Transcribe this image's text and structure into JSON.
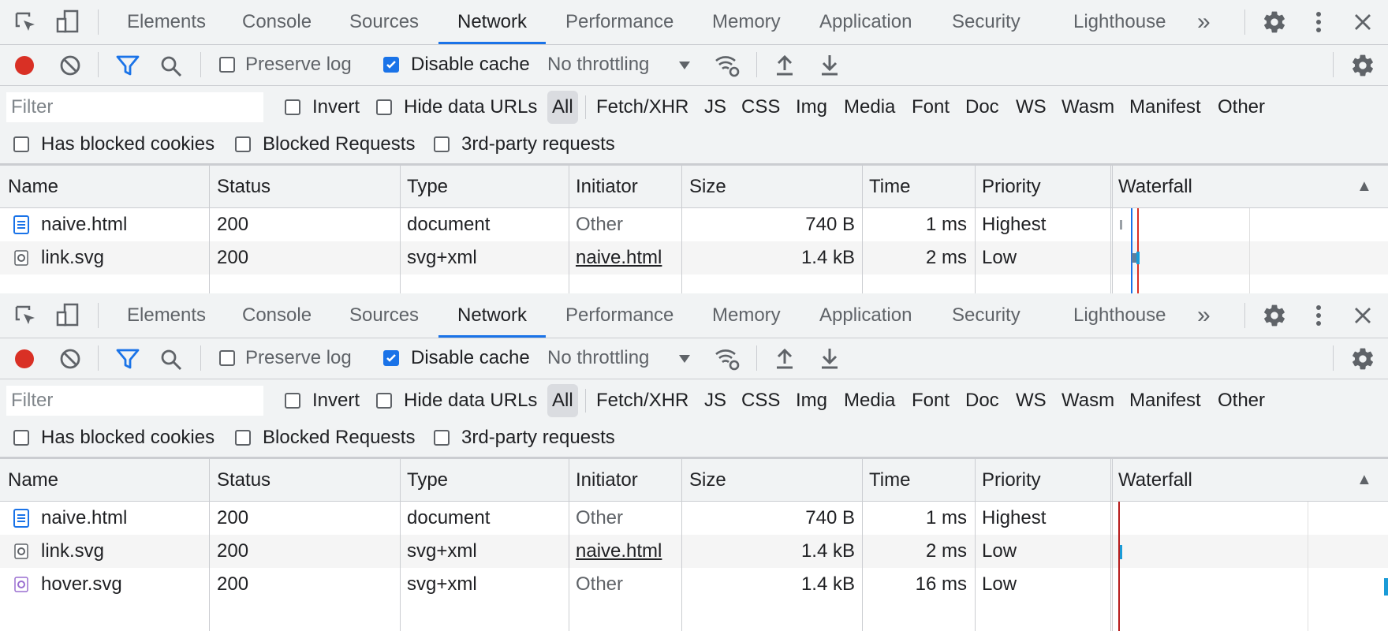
{
  "panels": [
    {
      "tabs": [
        "Elements",
        "Console",
        "Sources",
        "Network",
        "Performance",
        "Memory",
        "Application",
        "Security",
        "Lighthouse"
      ],
      "active_tab": "Network",
      "more_tabs": "»",
      "toolbar": {
        "preserve_log": "Preserve log",
        "disable_cache": "Disable cache",
        "throttling": "No throttling"
      },
      "filter": {
        "placeholder": "Filter",
        "invert": "Invert",
        "hide_data_urls": "Hide data URLs",
        "types": [
          "All",
          "Fetch/XHR",
          "JS",
          "CSS",
          "Img",
          "Media",
          "Font",
          "Doc",
          "WS",
          "Wasm",
          "Manifest",
          "Other"
        ],
        "has_blocked_cookies": "Has blocked cookies",
        "blocked_requests": "Blocked Requests",
        "third_party": "3rd-party requests"
      },
      "columns": [
        "Name",
        "Status",
        "Type",
        "Initiator",
        "Size",
        "Time",
        "Priority",
        "Waterfall"
      ],
      "sort_indicator": "▲",
      "rows": [
        {
          "name": "naive.html",
          "status": "200",
          "type": "document",
          "initiator": "Other",
          "size": "740 B",
          "time": "1 ms",
          "priority": "Highest",
          "icon": "document-icon"
        },
        {
          "name": "link.svg",
          "status": "200",
          "type": "svg+xml",
          "initiator": "naive.html",
          "size": "1.4 kB",
          "time": "2 ms",
          "priority": "Low",
          "icon": "svg-file-icon"
        }
      ]
    },
    {
      "tabs": [
        "Elements",
        "Console",
        "Sources",
        "Network",
        "Performance",
        "Memory",
        "Application",
        "Security",
        "Lighthouse"
      ],
      "active_tab": "Network",
      "more_tabs": "»",
      "toolbar": {
        "preserve_log": "Preserve log",
        "disable_cache": "Disable cache",
        "throttling": "No throttling"
      },
      "filter": {
        "placeholder": "Filter",
        "invert": "Invert",
        "hide_data_urls": "Hide data URLs",
        "types": [
          "All",
          "Fetch/XHR",
          "JS",
          "CSS",
          "Img",
          "Media",
          "Font",
          "Doc",
          "WS",
          "Wasm",
          "Manifest",
          "Other"
        ],
        "has_blocked_cookies": "Has blocked cookies",
        "blocked_requests": "Blocked Requests",
        "third_party": "3rd-party requests"
      },
      "columns": [
        "Name",
        "Status",
        "Type",
        "Initiator",
        "Size",
        "Time",
        "Priority",
        "Waterfall"
      ],
      "sort_indicator": "▲",
      "rows": [
        {
          "name": "naive.html",
          "status": "200",
          "type": "document",
          "initiator": "Other",
          "size": "740 B",
          "time": "1 ms",
          "priority": "Highest",
          "icon": "document-icon"
        },
        {
          "name": "link.svg",
          "status": "200",
          "type": "svg+xml",
          "initiator": "naive.html",
          "size": "1.4 kB",
          "time": "2 ms",
          "priority": "Low",
          "icon": "svg-file-icon"
        },
        {
          "name": "hover.svg",
          "status": "200",
          "type": "svg+xml",
          "initiator": "Other",
          "size": "1.4 kB",
          "time": "16 ms",
          "priority": "Low",
          "icon": "svg-file-icon"
        }
      ]
    }
  ],
  "colors": {
    "accent": "#1a73e8",
    "record": "#d93025",
    "toolbar_bg": "#f1f3f4"
  }
}
